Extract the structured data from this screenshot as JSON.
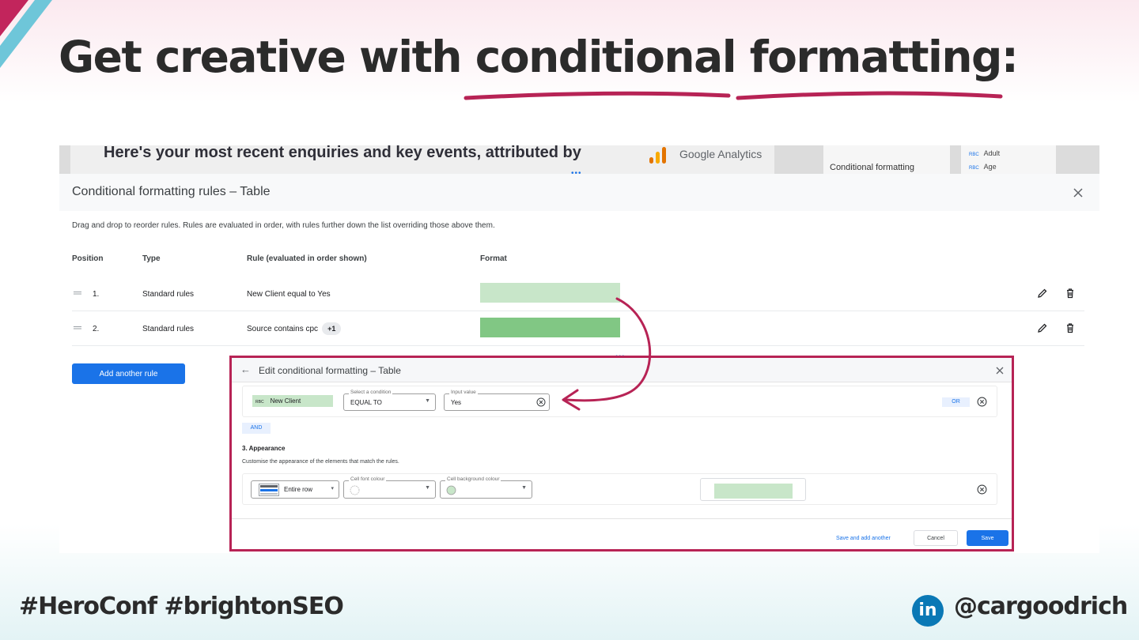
{
  "slide": {
    "title": "Get creative with conditional formatting:",
    "hashtags": "#HeroConf #brightonSEO",
    "handle": "@cargoodrich",
    "accent_color": "#b72355",
    "brand_icon": "linkedin-icon",
    "brand_icon_glyph": "in"
  },
  "report": {
    "heading": "Here's your most recent enquiries and key events, attributed by",
    "ga_text": "Google Analytics",
    "side_label": "Conditional formatting",
    "side_fields": [
      "Adult",
      "Age"
    ],
    "field_type": "RBC"
  },
  "rules_dialog": {
    "title": "Conditional formatting rules – Table",
    "intro": "Drag and drop to reorder rules. Rules are evaluated in order, with rules further down the list overriding those above them.",
    "columns": [
      "Position",
      "Type",
      "Rule (evaluated in order shown)",
      "Format"
    ],
    "rows": [
      {
        "position": "1.",
        "type": "Standard rules",
        "rule": "New Client equal to Yes",
        "extra": "",
        "format_color": "#c8e6c9"
      },
      {
        "position": "2.",
        "type": "Standard rules",
        "rule": "Source contains cpc",
        "extra": "+1",
        "format_color": "#81c784"
      }
    ],
    "add_button": "Add another rule"
  },
  "edit_dialog": {
    "title": "Edit conditional formatting – Table",
    "field": "New Client",
    "field_type": "RBC",
    "condition_label": "Select a condition",
    "condition_value": "EQUAL TO",
    "input_label": "Input value",
    "input_value": "Yes",
    "or_label": "OR",
    "and_label": "AND",
    "appearance_title": "3. Appearance",
    "appearance_desc": "Customise the appearance of the elements that match the rules.",
    "apply_to": "Entire row",
    "font_colour_label": "Cell font colour",
    "bg_colour_label": "Cell background colour",
    "bg_colour": "#c8e6c9",
    "save_and_add": "Save and add another",
    "cancel": "Cancel",
    "save": "Save"
  }
}
